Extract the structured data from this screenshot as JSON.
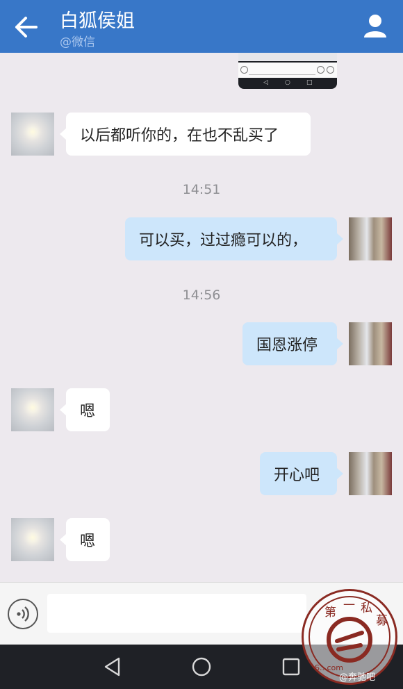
{
  "header": {
    "title": "白狐侯姐",
    "subtitle": "@微信"
  },
  "messages": [
    {
      "side": "left",
      "text": "以后都听你的，在也不乱买了"
    },
    {
      "time": "14:51"
    },
    {
      "side": "right",
      "text": "可以买，过过瘾可以的，"
    },
    {
      "time": "14:56"
    },
    {
      "side": "right",
      "text": "国恩涨停"
    },
    {
      "side": "left",
      "text": "嗯"
    },
    {
      "side": "right",
      "text": "开心吧"
    },
    {
      "side": "left",
      "text": "嗯"
    }
  ],
  "input": {
    "value": "",
    "placeholder": ""
  },
  "watermark": {
    "stamp_text": "第一私募",
    "site_text": "S...com",
    "caption": "@奔驰吧"
  },
  "colors": {
    "header": "#3877c8",
    "background": "#ede9ee",
    "bubble_sent": "#cde6fb",
    "bubble_received": "#ffffff",
    "navbar": "#1f2126"
  },
  "icons": {
    "back": "arrow-left-icon",
    "profile": "person-icon",
    "voice": "voice-icon",
    "nav_back": "triangle-back-icon",
    "nav_home": "circle-home-icon",
    "nav_recent": "square-recent-icon"
  }
}
